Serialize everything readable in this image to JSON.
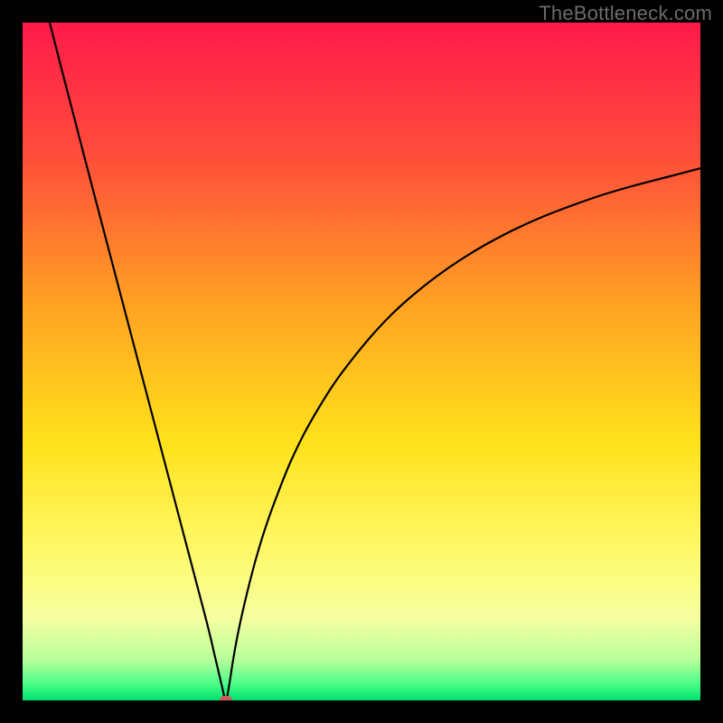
{
  "watermark": "TheBottleneck.com",
  "chart_data": {
    "type": "line",
    "title": "",
    "xlabel": "",
    "ylabel": "",
    "xlim": [
      0,
      100
    ],
    "ylim": [
      0,
      100
    ],
    "grid": false,
    "legend": false,
    "gradient_stops": [
      {
        "offset": 0,
        "color": "#ff1a4b"
      },
      {
        "offset": 0.2,
        "color": "#ff4f3a"
      },
      {
        "offset": 0.42,
        "color": "#ffa322"
      },
      {
        "offset": 0.62,
        "color": "#ffe21a"
      },
      {
        "offset": 0.78,
        "color": "#fff96a"
      },
      {
        "offset": 0.88,
        "color": "#f5ffa2"
      },
      {
        "offset": 0.94,
        "color": "#b7ff9a"
      },
      {
        "offset": 0.975,
        "color": "#4dff8a"
      },
      {
        "offset": 1.0,
        "color": "#00e06e"
      }
    ],
    "series": [
      {
        "name": "bottleneck-curve",
        "color": "#000000",
        "x": [
          4,
          6,
          8,
          10,
          12,
          14,
          16,
          18,
          20,
          22,
          24,
          26,
          27,
          27.8,
          28.3,
          28.8,
          29.2,
          29.5,
          29.7,
          29.85,
          30,
          30.15,
          30.3,
          30.6,
          31,
          31.6,
          32.4,
          33.4,
          34.6,
          36,
          37.6,
          39.4,
          41.4,
          43.6,
          46,
          48.6,
          51.4,
          54.4,
          57.6,
          61,
          64.6,
          68.4,
          72.4,
          76.6,
          81,
          85.6,
          90.4,
          95.4,
          100
        ],
        "values": [
          100,
          92.2,
          84.5,
          76.8,
          69.2,
          61.6,
          54.0,
          46.4,
          38.8,
          31.2,
          23.6,
          16.0,
          12.2,
          9.0,
          6.8,
          4.7,
          3.0,
          1.7,
          0.8,
          0.2,
          0.0,
          0.35,
          1.2,
          3.0,
          5.6,
          9.0,
          12.8,
          17.0,
          21.5,
          26.0,
          30.4,
          34.9,
          39.1,
          43.0,
          46.8,
          50.3,
          53.7,
          56.9,
          59.8,
          62.5,
          65.0,
          67.3,
          69.4,
          71.3,
          73.0,
          74.6,
          76.0,
          77.3,
          78.5
        ]
      }
    ],
    "marker": {
      "x": 30,
      "y": 0,
      "color": "#cc5a5a"
    }
  }
}
